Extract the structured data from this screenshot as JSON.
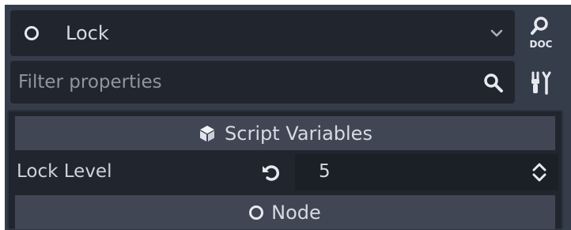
{
  "object_selector": {
    "name": "Lock",
    "icon": "node-circle-icon",
    "dropdown_icon": "chevron-down-icon"
  },
  "doc_button": {
    "icon": "doc-search-icon",
    "text": "DOC"
  },
  "filter": {
    "placeholder": "Filter properties",
    "value": "",
    "icon": "search-icon"
  },
  "tools_button": {
    "icon": "tools-icon"
  },
  "sections": {
    "script_variables": {
      "label": "Script Variables",
      "icon": "cube-icon"
    },
    "node": {
      "label": "Node",
      "icon": "node-circle-icon"
    }
  },
  "properties": [
    {
      "label": "Lock Level",
      "value": "5",
      "revert_icon": "revert-icon",
      "control_icon": "updown-arrows-icon"
    }
  ],
  "colors": {
    "panel_bg": "#363d4a",
    "field_bg": "#21262e",
    "header_bg": "#404654",
    "text": "#d6dae2",
    "placeholder": "#8f96a3"
  }
}
